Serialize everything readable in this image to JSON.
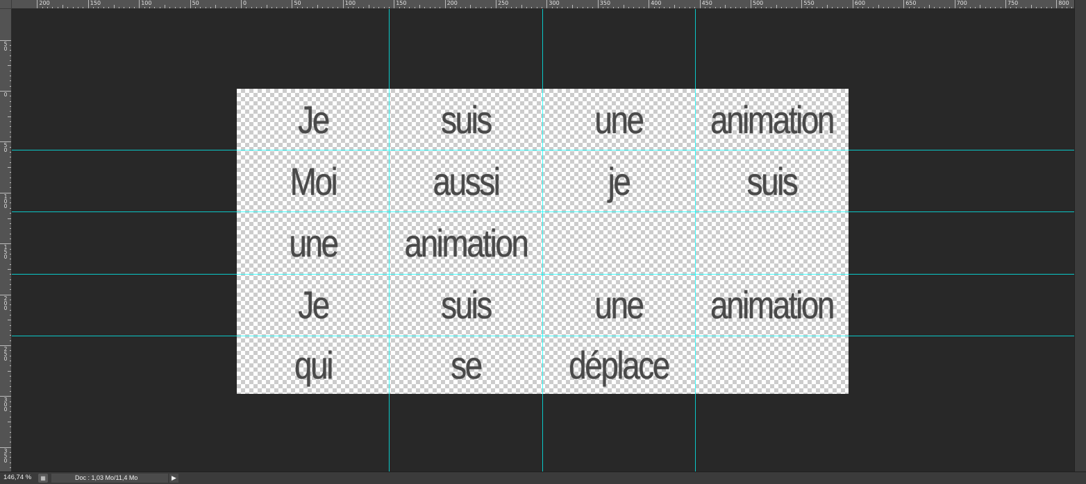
{
  "ruler_top": {
    "labels": [
      "200",
      "150",
      "100",
      "50",
      "0",
      "50",
      "100",
      "150",
      "200",
      "250",
      "300",
      "350",
      "400",
      "450",
      "500",
      "550",
      "600",
      "650",
      "700",
      "750",
      "800"
    ]
  },
  "ruler_left": {
    "labels": [
      "50",
      "0",
      "50",
      "100",
      "150",
      "200",
      "250",
      "300",
      "350"
    ]
  },
  "canvas": {
    "cells": [
      [
        "Je",
        "suis",
        "une",
        "animation"
      ],
      [
        "Moi",
        "aussi",
        "je",
        "suis"
      ],
      [
        "une",
        "animation",
        "",
        ""
      ],
      [
        "Je",
        "suis",
        "une",
        "animation"
      ],
      [
        "qui",
        "se",
        "déplace",
        ""
      ]
    ]
  },
  "statusbar": {
    "zoom": "146,74 %",
    "doc": "Doc : 1,03 Mo/11,4 Mo",
    "arrow": "▶",
    "icon": "doc-info-icon"
  },
  "colors": {
    "guide": "#00ffff",
    "pasteboard": "#282828",
    "ruler": "#535353"
  }
}
